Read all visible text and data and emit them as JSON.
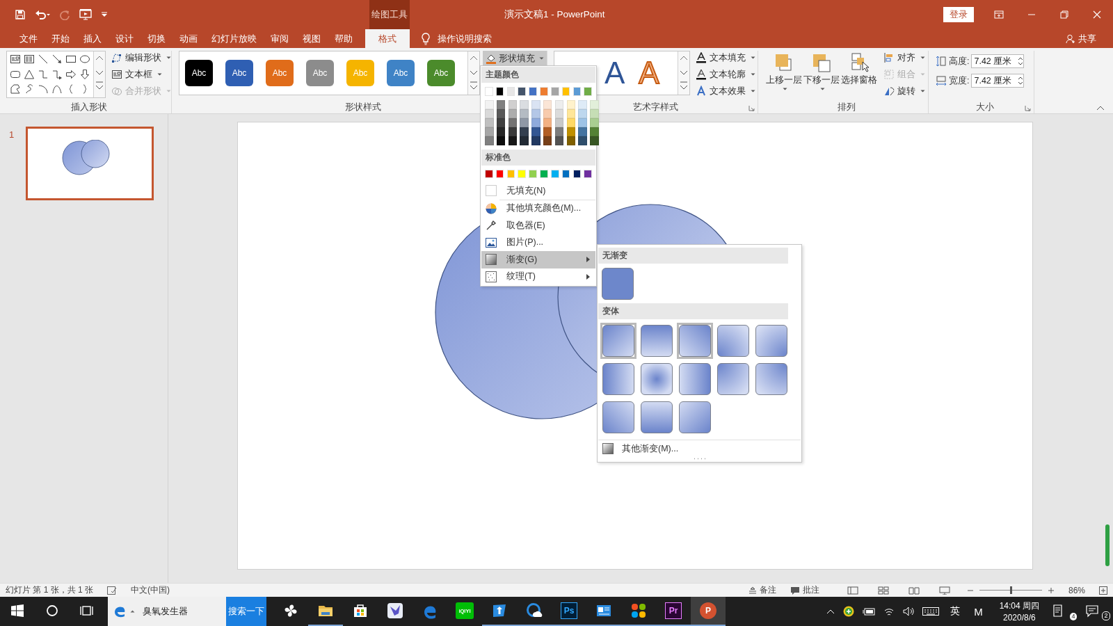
{
  "window": {
    "title": "演示文稿1 - PowerPoint",
    "context_group": "绘图工具",
    "sign_in": "登录"
  },
  "tabs": [
    {
      "label": "文件",
      "selected": false
    },
    {
      "label": "开始",
      "selected": false
    },
    {
      "label": "插入",
      "selected": false
    },
    {
      "label": "设计",
      "selected": false
    },
    {
      "label": "切换",
      "selected": false
    },
    {
      "label": "动画",
      "selected": false
    },
    {
      "label": "幻灯片放映",
      "selected": false
    },
    {
      "label": "审阅",
      "selected": false
    },
    {
      "label": "视图",
      "selected": false
    },
    {
      "label": "帮助",
      "selected": false
    },
    {
      "label": "格式",
      "selected": true
    }
  ],
  "tell_me": "操作说明搜索",
  "share": "共享",
  "insert_shapes": {
    "label": "插入形状",
    "commands": [
      {
        "label": "编辑形状",
        "kind": "edit-shape",
        "disabled": false
      },
      {
        "label": "文本框",
        "kind": "text-box",
        "disabled": false
      },
      {
        "label": "合并形状",
        "kind": "merge-shapes",
        "disabled": true
      }
    ]
  },
  "shape_styles": {
    "label": "形状样式",
    "presets": [
      {
        "label": "Abc",
        "color": "#000000"
      },
      {
        "label": "Abc",
        "color": "#2f5fb3"
      },
      {
        "label": "Abc",
        "color": "#e06c1a"
      },
      {
        "label": "Abc",
        "color": "#8c8c8c"
      },
      {
        "label": "Abc",
        "color": "#f5b400"
      },
      {
        "label": "Abc",
        "color": "#3f83c6"
      },
      {
        "label": "Abc",
        "color": "#4b8b2b"
      }
    ],
    "fill_button": {
      "label": "形状填充",
      "expanded": true
    }
  },
  "wordart_styles": {
    "label": "艺术字样式",
    "samples": [
      {
        "label": "A",
        "kind": "fill"
      },
      {
        "label": "A",
        "kind": "outline"
      }
    ],
    "commands": [
      {
        "label": "文本填充",
        "kind": "text-fill"
      },
      {
        "label": "文本轮廓",
        "kind": "text-outline"
      },
      {
        "label": "文本效果",
        "kind": "text-effects"
      }
    ]
  },
  "arrange": {
    "label": "排列",
    "large_commands": [
      {
        "label": "上移一层",
        "kind": "bring-forward"
      },
      {
        "label": "下移一层",
        "kind": "send-backward"
      },
      {
        "label": "选择窗格",
        "kind": "selection-pane"
      }
    ],
    "commands": [
      {
        "label": "对齐",
        "kind": "align",
        "disabled": false
      },
      {
        "label": "组合",
        "kind": "group",
        "disabled": true
      },
      {
        "label": "旋转",
        "kind": "rotate",
        "disabled": false
      }
    ]
  },
  "size": {
    "label": "大小",
    "fields": [
      {
        "label": "高度:",
        "value": "7.42 厘米",
        "kind": "height"
      },
      {
        "label": "宽度:",
        "value": "7.42 厘米",
        "kind": "width"
      }
    ]
  },
  "thumbnails": [
    {
      "number": "1",
      "selected": true
    }
  ],
  "fill_menu": {
    "theme_label": "主题颜色",
    "theme_colors": [
      {
        "color": "#ffffff"
      },
      {
        "color": "#000000"
      },
      {
        "color": "#e7e6e6"
      },
      {
        "color": "#44546a"
      },
      {
        "color": "#4472c4"
      },
      {
        "color": "#ed7d31"
      },
      {
        "color": "#a5a5a5"
      },
      {
        "color": "#ffc000"
      },
      {
        "color": "#5b9bd5"
      },
      {
        "color": "#70ad47"
      }
    ],
    "standard_label": "标准色",
    "standard_colors": [
      {
        "color": "#c00000"
      },
      {
        "color": "#ff0000"
      },
      {
        "color": "#ffc000"
      },
      {
        "color": "#ffff00"
      },
      {
        "color": "#92d050"
      },
      {
        "color": "#00b050"
      },
      {
        "color": "#00b0f0"
      },
      {
        "color": "#0070c0"
      },
      {
        "color": "#002060"
      },
      {
        "color": "#7030a0"
      }
    ],
    "items": [
      {
        "label": "无填充(N)",
        "kind": "no-fill",
        "submenu": false,
        "selected": false
      },
      {
        "label": "其他填充颜色(M)...",
        "kind": "more-colors",
        "submenu": false,
        "selected": false
      },
      {
        "label": "取色器(E)",
        "kind": "eyedropper",
        "submenu": false,
        "selected": false
      },
      {
        "label": "图片(P)...",
        "kind": "picture",
        "submenu": false,
        "selected": false
      },
      {
        "label": "渐变(G)",
        "kind": "gradient",
        "submenu": true,
        "selected": true
      },
      {
        "label": "纹理(T)",
        "kind": "texture",
        "submenu": true,
        "selected": false
      }
    ]
  },
  "gradient_menu": {
    "none_label": "无渐变",
    "variations_label": "变体",
    "variations": [
      {
        "kind": "diagonal-tl",
        "selected": true
      },
      {
        "kind": "top",
        "selected": false
      },
      {
        "kind": "diagonal-tr",
        "selected": true
      },
      {
        "kind": "corner-bl",
        "selected": false
      },
      {
        "kind": "corner-br",
        "selected": false
      },
      {
        "kind": "left",
        "selected": false
      },
      {
        "kind": "radial",
        "selected": false
      },
      {
        "kind": "right",
        "selected": false
      },
      {
        "kind": "corner-tl",
        "selected": false
      },
      {
        "kind": "corner-tr",
        "selected": false
      },
      {
        "kind": "diagonal-bl",
        "selected": false
      },
      {
        "kind": "bottom",
        "selected": false
      },
      {
        "kind": "diagonal-br",
        "selected": false
      }
    ],
    "more": "其他渐变(M)..."
  },
  "status_bar": {
    "slide_info": "幻灯片 第 1 张，共 1 张",
    "language": "中文(中国)",
    "notes": "备注",
    "comments": "批注",
    "zoom_slider": {
      "level": 0.5
    },
    "zoom": "86%"
  },
  "taskbar": {
    "search_text": "臭氧发生器",
    "search_button": "搜索一下",
    "apps": [
      {
        "kind": "pinwheel",
        "running": false,
        "selected": false
      },
      {
        "kind": "folder",
        "running": true,
        "selected": false
      },
      {
        "kind": "store",
        "running": false,
        "selected": false
      },
      {
        "kind": "bird",
        "running": false,
        "selected": false
      },
      {
        "kind": "edge",
        "running": false,
        "selected": false
      },
      {
        "kind": "video",
        "label": "iQIYI",
        "running": false,
        "selected": false
      },
      {
        "kind": "arrow-tile",
        "running": true,
        "selected": false
      },
      {
        "kind": "cloud",
        "running": true,
        "selected": false
      },
      {
        "kind": "logo-blue",
        "label": "Ps",
        "running": true,
        "selected": false
      },
      {
        "kind": "card",
        "running": true,
        "selected": false
      },
      {
        "kind": "petals",
        "running": true,
        "selected": false
      },
      {
        "kind": "logo-purple",
        "label": "Pr",
        "running": true,
        "selected": false
      },
      {
        "kind": "logo-orange",
        "label": "P",
        "running": true,
        "selected": true
      }
    ],
    "ime": "英",
    "ime_mode": "M",
    "time": "14:04 周四",
    "date": "2020/8/6",
    "notes_badge": "4",
    "action_badge": "2"
  }
}
